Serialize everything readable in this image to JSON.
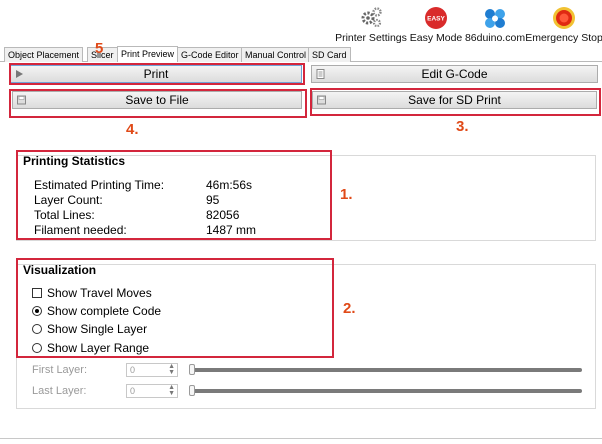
{
  "toolbar": {
    "items": [
      {
        "label": "Printer Settings",
        "icon": "gears-icon"
      },
      {
        "label": "Easy Mode",
        "icon": "easy-mode-icon",
        "badge": "EASY"
      },
      {
        "label": "86duino.com",
        "icon": "86duino-logo-icon"
      },
      {
        "label": "Emergency Stop",
        "icon": "emergency-stop-icon"
      }
    ]
  },
  "tabs": [
    {
      "label": "Object Placement"
    },
    {
      "label": "Slicer"
    },
    {
      "label": "Print Preview",
      "active": true
    },
    {
      "label": "G-Code Editor"
    },
    {
      "label": "Manual Control"
    },
    {
      "label": "SD Card"
    }
  ],
  "buttons": {
    "print": "Print",
    "edit_gcode": "Edit G-Code",
    "save_to_file": "Save to File",
    "save_sd": "Save for SD Print"
  },
  "stats": {
    "title": "Printing Statistics",
    "rows": [
      {
        "label": "Estimated Printing Time:",
        "value": "46m:56s"
      },
      {
        "label": "Layer Count:",
        "value": "95"
      },
      {
        "label": "Total Lines:",
        "value": "82056"
      },
      {
        "label": "Filament needed:",
        "value": "1487 mm"
      }
    ]
  },
  "visualization": {
    "title": "Visualization",
    "options": [
      {
        "label": "Show Travel Moves",
        "type": "checkbox",
        "checked": false
      },
      {
        "label": "Show complete Code",
        "type": "radio",
        "checked": true
      },
      {
        "label": "Show Single Layer",
        "type": "radio",
        "checked": false
      },
      {
        "label": "Show Layer Range",
        "type": "radio",
        "checked": false
      }
    ],
    "first_layer": {
      "label": "First Layer:",
      "value": "0"
    },
    "last_layer": {
      "label": "Last Layer:",
      "value": "0"
    }
  },
  "annotations": [
    "1.",
    "2.",
    "3.",
    "4.",
    "5"
  ],
  "colors": {
    "highlight": "#d3263c",
    "annotation_number": "#e04a18"
  }
}
